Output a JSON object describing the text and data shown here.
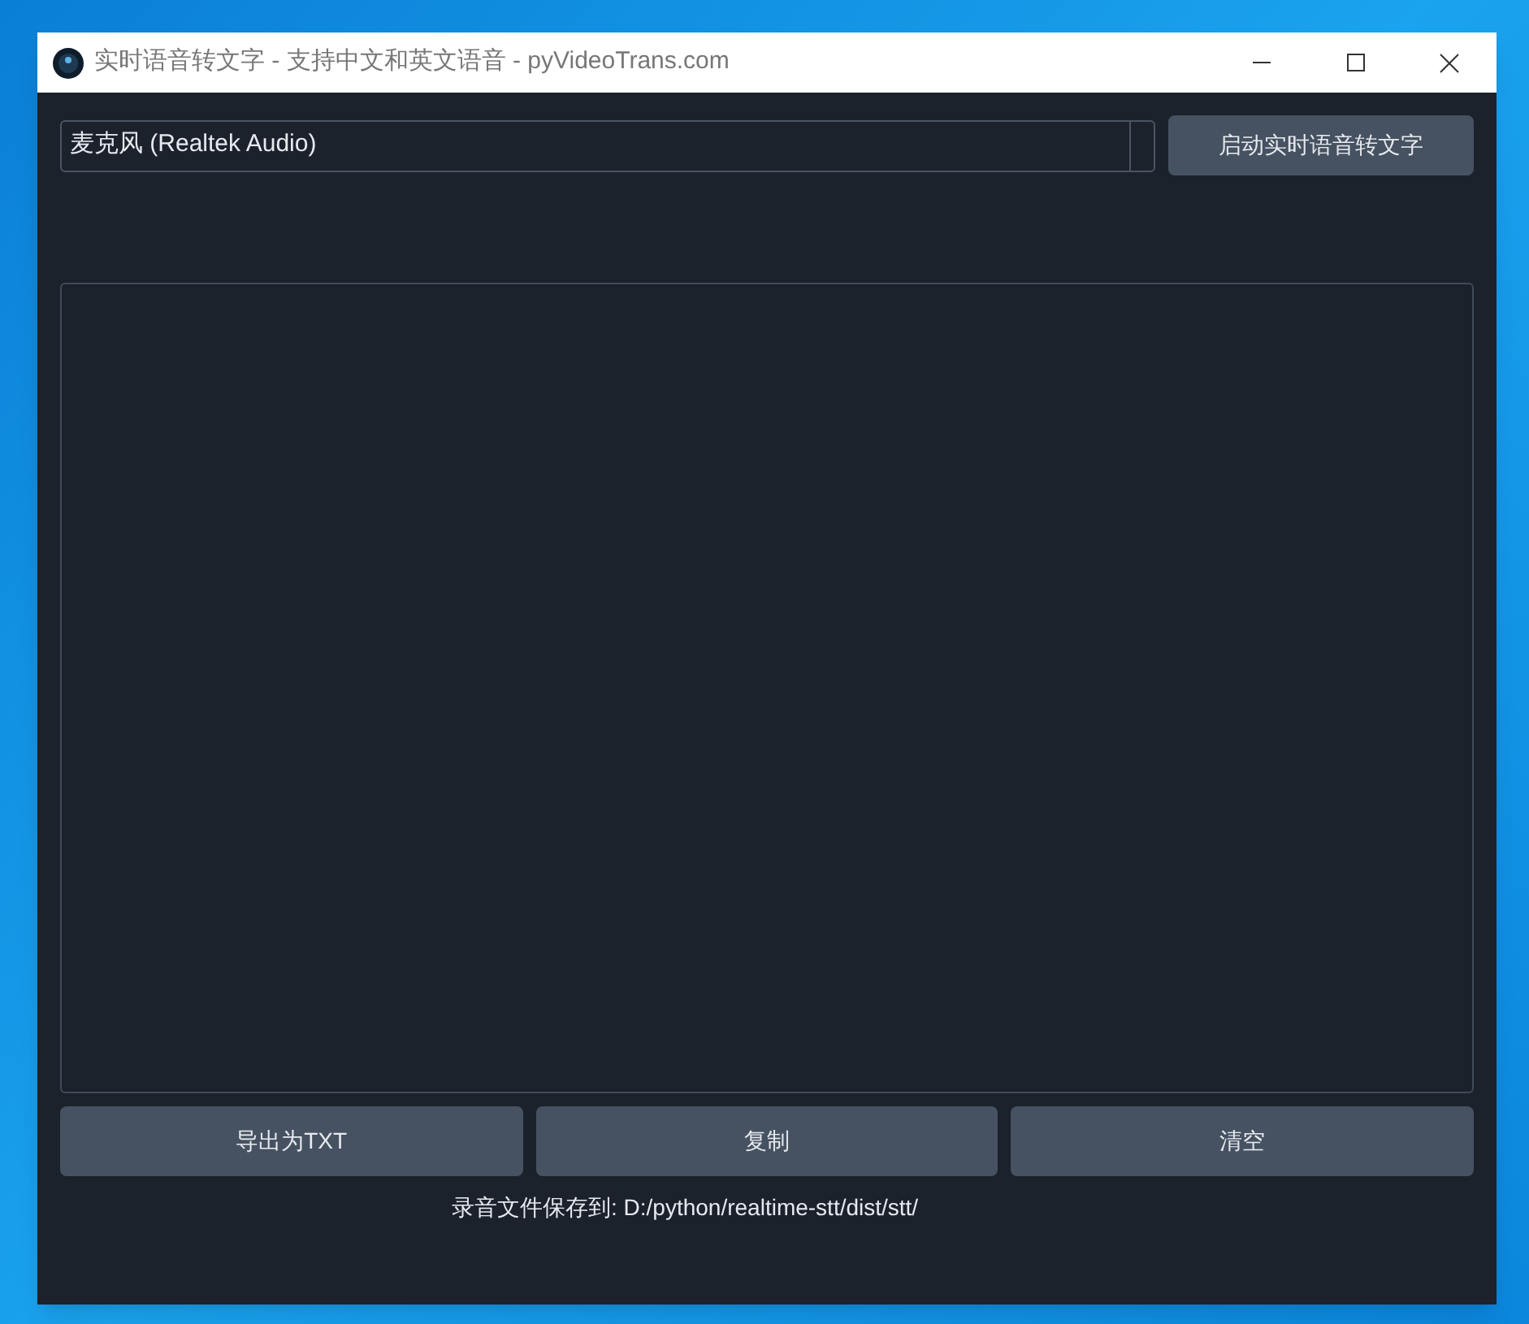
{
  "window": {
    "title": "实时语音转文字 - 支持中文和英文语音 - pyVideoTrans.com"
  },
  "device_select": {
    "value": "麦克风 (Realtek Audio)"
  },
  "start_button": {
    "label": "启动实时语音转文字"
  },
  "buttons": [
    {
      "label": "导出为TXT"
    },
    {
      "label": "复制"
    },
    {
      "label": "清空"
    }
  ],
  "status_bar": {
    "text": "录音文件保存到: D:/python/realtime-stt/dist/stt/"
  }
}
